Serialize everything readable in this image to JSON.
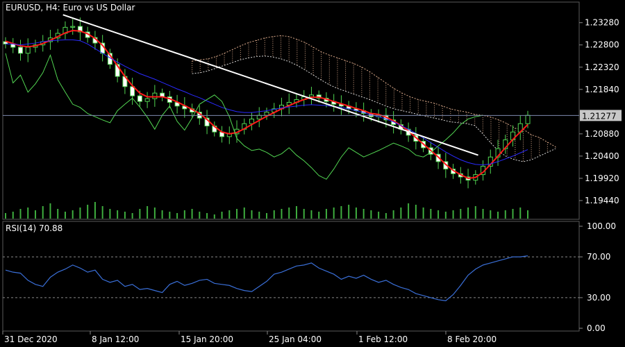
{
  "chart_data": [
    {
      "type": "candlestick",
      "title": "EURUSD, H4:  Euro vs US Dollar",
      "ylim": [
        1.1905,
        1.2365
      ],
      "y_ticks": [
        1.2328,
        1.228,
        1.2232,
        1.2184,
        1.2088,
        1.204,
        1.1992,
        1.1944
      ],
      "last_price": 1.21277,
      "trendline": {
        "from": {
          "x": 0.11,
          "y": 1.2345
        },
        "to": {
          "x": 0.905,
          "y": 1.2042
        },
        "color": "#ffffff"
      },
      "close_series": [
        1.2282,
        1.2275,
        1.2262,
        1.2275,
        1.228,
        1.2287,
        1.2295,
        1.2305,
        1.2318,
        1.232,
        1.2308,
        1.2296,
        1.2284,
        1.2262,
        1.2238,
        1.2212,
        1.219,
        1.217,
        1.2158,
        1.2164,
        1.2176,
        1.2168,
        1.2156,
        1.2148,
        1.2142,
        1.2135,
        1.2122,
        1.2105,
        1.2092,
        1.2082,
        1.2088,
        1.2098,
        1.211,
        1.212,
        1.2128,
        1.2135,
        1.2142,
        1.215,
        1.2156,
        1.2162,
        1.2168,
        1.2172,
        1.2165,
        1.2158,
        1.2152,
        1.2148,
        1.2142,
        1.2138,
        1.2132,
        1.2125,
        1.2128,
        1.2118,
        1.2108,
        1.2098,
        1.2085,
        1.2072,
        1.2058,
        1.2044,
        1.2028,
        1.2012,
        1.2002,
        1.1995,
        1.1988,
        1.2,
        1.2018,
        1.2038,
        1.2056,
        1.2075,
        1.2092,
        1.211,
        1.2128
      ],
      "indicators": [
        {
          "name": "ma_red",
          "color": "#ff1a1a",
          "values": [
            1.2288,
            1.2283,
            1.2278,
            1.2276,
            1.2278,
            1.2283,
            1.229,
            1.2298,
            1.2306,
            1.2311,
            1.231,
            1.2304,
            1.2294,
            1.2279,
            1.2258,
            1.2235,
            1.2212,
            1.2192,
            1.2176,
            1.2168,
            1.2168,
            1.2168,
            1.2164,
            1.2157,
            1.2149,
            1.2141,
            1.2132,
            1.2119,
            1.2104,
            1.2092,
            1.2088,
            1.2091,
            1.2099,
            1.2108,
            1.2117,
            1.2126,
            1.2134,
            1.2142,
            1.2149,
            1.2156,
            1.2162,
            1.2167,
            1.2167,
            1.2163,
            1.2158,
            1.2153,
            1.2148,
            1.2143,
            1.2138,
            1.2132,
            1.213,
            1.2124,
            1.2116,
            1.2106,
            1.2094,
            1.208,
            1.2066,
            1.2052,
            1.2038,
            1.2022,
            1.2009,
            1.2,
            1.1992,
            1.1994,
            1.2005,
            1.2022,
            1.204,
            1.2058,
            1.2076,
            1.2092,
            1.2108
          ]
        },
        {
          "name": "ma_blue",
          "color": "#2a2aff",
          "values": [
            1.2282,
            1.2282,
            1.228,
            1.2282,
            1.2284,
            1.2287,
            1.2289,
            1.229,
            1.2291,
            1.2291,
            1.2289,
            1.2282,
            1.2272,
            1.2262,
            1.2252,
            1.2243,
            1.2234,
            1.2226,
            1.2218,
            1.2212,
            1.2206,
            1.2199,
            1.2192,
            1.2185,
            1.2179,
            1.2172,
            1.2166,
            1.2159,
            1.2152,
            1.2145,
            1.214,
            1.2136,
            1.2134,
            1.2134,
            1.2136,
            1.2138,
            1.2141,
            1.2144,
            1.2146,
            1.2148,
            1.215,
            1.2151,
            1.215,
            1.2149,
            1.2147,
            1.2145,
            1.2142,
            1.2138,
            1.2134,
            1.2129,
            1.2125,
            1.212,
            1.2114,
            1.2106,
            1.2098,
            1.2089,
            1.2079,
            1.2069,
            1.2059,
            1.2049,
            1.204,
            1.2032,
            1.2026,
            1.2022,
            1.2021,
            1.2023,
            1.2028,
            1.2034,
            1.204,
            1.2047,
            1.2054
          ]
        },
        {
          "name": "lagging_green",
          "color": "#52d652",
          "values": [
            1.2262,
            1.2198,
            1.2215,
            1.2178,
            1.2196,
            1.222,
            1.2258,
            1.2205,
            1.2178,
            1.2152,
            1.2145,
            1.2132,
            1.2125,
            1.2118,
            1.2112,
            1.2138,
            1.2152,
            1.2165,
            1.2146,
            1.2124,
            1.2098,
            1.2128,
            1.2148,
            1.2115,
            1.2096,
            1.2122,
            1.2152,
            1.2162,
            1.2172,
            1.2158,
            1.2125,
            1.2078,
            1.2062,
            1.2052,
            1.2055,
            1.2048,
            1.2038,
            1.2045,
            1.2058,
            1.2042,
            1.203,
            1.2015,
            1.1998,
            1.199,
            1.2012,
            1.2038,
            1.2058,
            1.2048,
            1.2038,
            1.2045,
            1.2052,
            1.206,
            1.2068,
            1.2062,
            1.2055,
            1.2042,
            1.2038,
            1.2048,
            1.2062,
            1.2075,
            1.209,
            1.2108,
            1.212,
            1.2125,
            1.2128
          ]
        }
      ],
      "cloud_upper": [
        1.2245,
        1.2248,
        1.225,
        1.2255,
        1.2262,
        1.227,
        1.2278,
        1.2285,
        1.229,
        1.2295,
        1.2298,
        1.23,
        1.2298,
        1.2292,
        1.2285,
        1.2275,
        1.2265,
        1.2258,
        1.2252,
        1.2246,
        1.224,
        1.2232,
        1.2222,
        1.221,
        1.2198,
        1.2186,
        1.2176,
        1.2168,
        1.2162,
        1.2158,
        1.2154,
        1.2148,
        1.2142,
        1.2138,
        1.2135,
        1.213,
        1.2128,
        1.2124,
        1.2118,
        1.211,
        1.21,
        1.2098,
        1.2086,
        1.208,
        1.207,
        1.206
      ],
      "cloud_lower": [
        1.2218,
        1.222,
        1.2224,
        1.223,
        1.2236,
        1.2242,
        1.2248,
        1.2252,
        1.2255,
        1.2256,
        1.2254,
        1.225,
        1.2244,
        1.2236,
        1.2226,
        1.2215,
        1.2204,
        1.2194,
        1.2186,
        1.218,
        1.2174,
        1.2168,
        1.2162,
        1.2155,
        1.2148,
        1.2142,
        1.2138,
        1.2134,
        1.213,
        1.2126,
        1.2122,
        1.2118,
        1.2114,
        1.2112,
        1.211,
        1.2106,
        1.2088,
        1.2068,
        1.205,
        1.2038,
        1.2032,
        1.2028,
        1.2032,
        1.204,
        1.2048,
        1.2056
      ],
      "cloud_colors": {
        "upper": "#d9a889",
        "lower": "#d9d9d9"
      },
      "volume_values": [
        8,
        10,
        14,
        16,
        12,
        18,
        22,
        14,
        10,
        12,
        16,
        20,
        24,
        18,
        14,
        12,
        10,
        8,
        14,
        18,
        16,
        12,
        10,
        8,
        12,
        14,
        10,
        8,
        6,
        10,
        12,
        14,
        16,
        12,
        10,
        8,
        12,
        14,
        16,
        18,
        14,
        12,
        10,
        14,
        16,
        18,
        20,
        16,
        14,
        12,
        10,
        8,
        12,
        16,
        22,
        20,
        16,
        14,
        12,
        10,
        12,
        14,
        16,
        18,
        14,
        12,
        10,
        12,
        14,
        16,
        12
      ]
    },
    {
      "type": "line",
      "title": "RSI(14) 70.88",
      "ylim": [
        0,
        100
      ],
      "y_ticks": [
        "100.00",
        "70.00",
        "30.00",
        "0.00"
      ],
      "levels": [
        70,
        30
      ],
      "series": [
        {
          "color": "#3a6fd8",
          "values": [
            57,
            55,
            54,
            47,
            43,
            41,
            50,
            55,
            58,
            62,
            59,
            55,
            57,
            48,
            45,
            47,
            41,
            43,
            38,
            39,
            37,
            35,
            43,
            46,
            42,
            44,
            47,
            48,
            44,
            43,
            42,
            39,
            37,
            36,
            41,
            46,
            53,
            55,
            58,
            61,
            62,
            64,
            59,
            56,
            53,
            48,
            51,
            49,
            52,
            48,
            45,
            47,
            43,
            40,
            38,
            34,
            32,
            30,
            28,
            27,
            33,
            42,
            52,
            58,
            62,
            64,
            66,
            68,
            70,
            70,
            71
          ]
        }
      ],
      "x_ticks": [
        "31 Dec 2020",
        "8 Jan 12:00",
        "15 Jan 20:00",
        "25 Jan 04:00",
        "1 Feb 12:00",
        "8 Feb 20:00"
      ]
    }
  ]
}
